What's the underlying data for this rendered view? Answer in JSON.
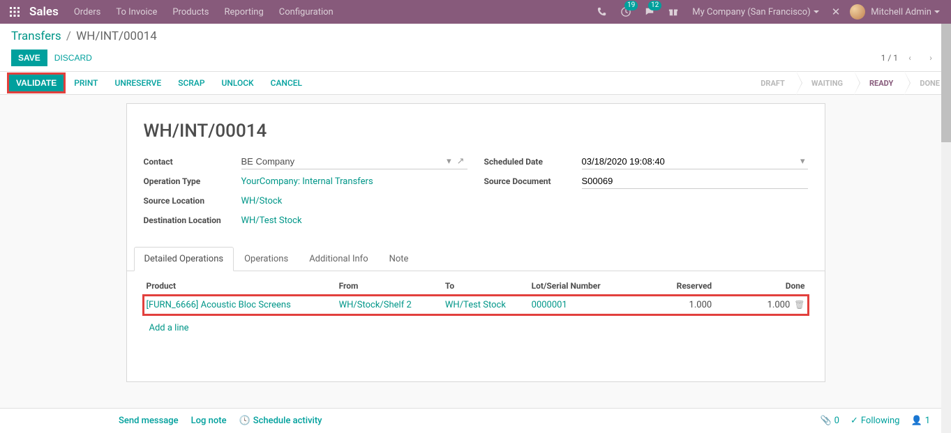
{
  "navbar": {
    "brand": "Sales",
    "menu": [
      "Orders",
      "To Invoice",
      "Products",
      "Reporting",
      "Configuration"
    ],
    "badges": {
      "clock": "19",
      "chat": "12"
    },
    "company": "My Company (San Francisco)",
    "username": "Mitchell Admin"
  },
  "breadcrumb": {
    "root": "Transfers",
    "current": "WH/INT/00014"
  },
  "actions": {
    "save": "SAVE",
    "discard": "DISCARD",
    "pager": "1 / 1"
  },
  "buttons": {
    "validate": "VALIDATE",
    "print": "PRINT",
    "unreserve": "UNRESERVE",
    "scrap": "SCRAP",
    "unlock": "UNLOCK",
    "cancel": "CANCEL"
  },
  "steps": [
    {
      "label": "DRAFT",
      "active": false
    },
    {
      "label": "WAITING",
      "active": false
    },
    {
      "label": "READY",
      "active": true
    },
    {
      "label": "DONE",
      "active": false
    }
  ],
  "title": "WH/INT/00014",
  "fields": {
    "contact_label": "Contact",
    "contact_value": "BE Company",
    "op_label": "Operation Type",
    "op_value": "YourCompany: Internal Transfers",
    "srcloc_label": "Source Location",
    "srcloc_value": "WH/Stock",
    "dstloc_label": "Destination Location",
    "dstloc_value": "WH/Test Stock",
    "sched_label": "Scheduled Date",
    "sched_value": "03/18/2020 19:08:40",
    "srcdoc_label": "Source Document",
    "srcdoc_value": "S00069"
  },
  "tabs": [
    "Detailed Operations",
    "Operations",
    "Additional Info",
    "Note"
  ],
  "table": {
    "headers": {
      "product": "Product",
      "from": "From",
      "to": "To",
      "lot": "Lot/Serial Number",
      "reserved": "Reserved",
      "done": "Done"
    },
    "rows": [
      {
        "product": "[FURN_6666] Acoustic Bloc Screens",
        "from": "WH/Stock/Shelf 2",
        "to": "WH/Test Stock",
        "lot": "0000001",
        "reserved": "1.000",
        "done": "1.000"
      }
    ],
    "add_line": "Add a line"
  },
  "chatter": {
    "send": "Send message",
    "log": "Log note",
    "schedule": "Schedule activity",
    "attach": "0",
    "following": "Following",
    "followers": "1"
  }
}
